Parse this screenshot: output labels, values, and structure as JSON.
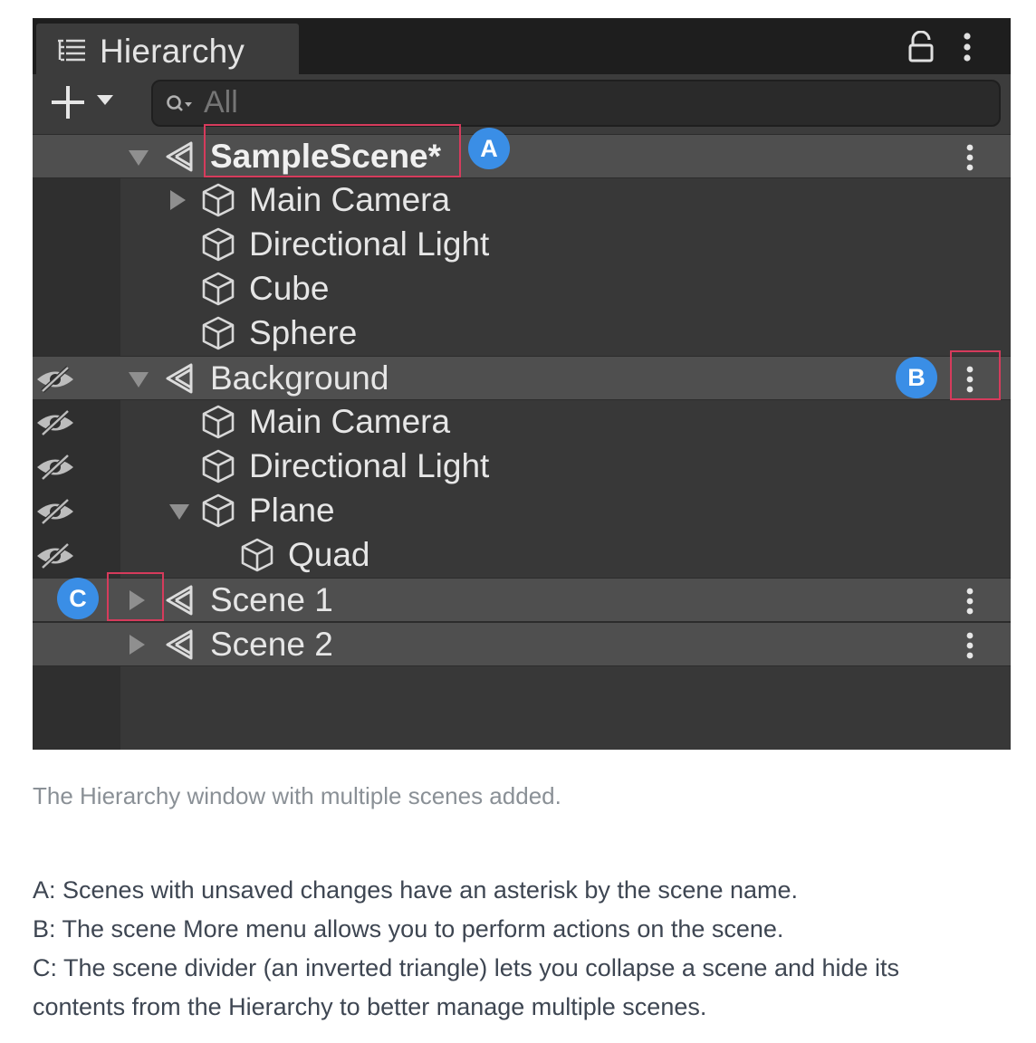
{
  "window": {
    "title": "Hierarchy",
    "search_placeholder": "All"
  },
  "rows": [
    {
      "label": "SampleScene*",
      "type": "scene"
    },
    {
      "label": "Main Camera",
      "type": "object"
    },
    {
      "label": "Directional Light",
      "type": "object"
    },
    {
      "label": "Cube",
      "type": "object"
    },
    {
      "label": "Sphere",
      "type": "object"
    },
    {
      "label": "Background",
      "type": "scene"
    },
    {
      "label": "Main Camera",
      "type": "object"
    },
    {
      "label": "Directional Light",
      "type": "object"
    },
    {
      "label": "Plane",
      "type": "object"
    },
    {
      "label": "Quad",
      "type": "object"
    },
    {
      "label": "Scene 1",
      "type": "scene"
    },
    {
      "label": "Scene 2",
      "type": "scene"
    }
  ],
  "callouts": {
    "a": "A",
    "b": "B",
    "c": "C"
  },
  "caption": "The Hierarchy window with multiple scenes added.",
  "notes": [
    "A: Scenes with unsaved changes have an asterisk by the scene name.",
    "B: The scene More menu allows you to perform actions on the scene.",
    "C: The scene divider (an inverted triangle) lets you collapse a scene and hide its",
    "contents from the Hierarchy to better manage multiple scenes."
  ],
  "colors": {
    "panel_bg": "#383838",
    "scene_row_bg": "#4f4f4f",
    "callout_badge": "#3a8ee6",
    "callout_outline": "#d63b5c"
  }
}
